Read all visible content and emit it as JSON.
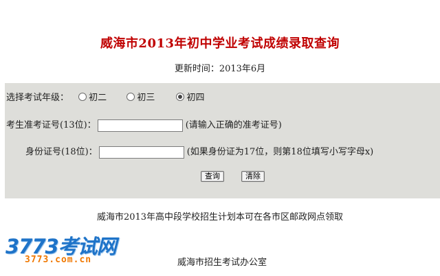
{
  "page_title": "威海市2013年初中学业考试成绩录取查询",
  "updated_text": "更新时间：2013年6月",
  "form": {
    "grade_label": "选择考试年级：",
    "grade_options": [
      "初二",
      "初三",
      "初四"
    ],
    "grade_selected": "初四",
    "exam_no_label": "考生准考证号(13位)：",
    "exam_no_value": "",
    "exam_no_hint": "(请输入正确的准考证号)",
    "id_label": "身份证号(18位)：",
    "id_value": "",
    "id_hint": "(如果身份证为17位，则第18位填写小写字母x)",
    "query_button": "查询",
    "clear_button": "清除"
  },
  "notice": "威海市2013年高中段学校招生计划本可在各市区邮政网点领取",
  "office": "威海市招生考试办公室",
  "logo": {
    "main": "3773考试网",
    "sub": "3773.com.cn"
  }
}
